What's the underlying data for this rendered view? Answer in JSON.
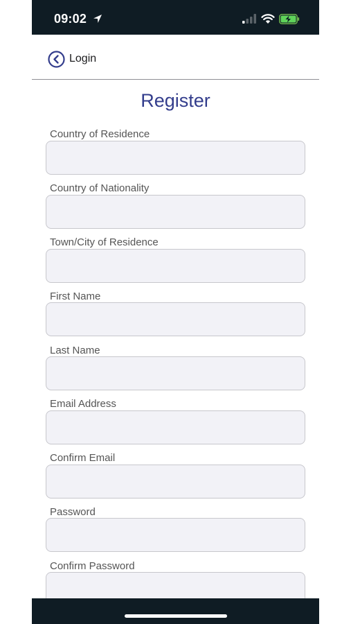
{
  "status_bar": {
    "time": "09:02",
    "icons": [
      "location-arrow-icon",
      "cellular-signal-icon",
      "wifi-icon",
      "battery-charging-icon"
    ]
  },
  "nav": {
    "back_label": "Login",
    "back_icon": "chevron-left-circle-icon",
    "accent_color": "#333d8c"
  },
  "page": {
    "title": "Register"
  },
  "form": {
    "fields": [
      {
        "label": "Country of Residence",
        "value": ""
      },
      {
        "label": "Country of Nationality",
        "value": ""
      },
      {
        "label": "Town/City of Residence",
        "value": ""
      },
      {
        "label": "First Name",
        "value": ""
      },
      {
        "label": "Last Name",
        "value": ""
      },
      {
        "label": "Email Address",
        "value": ""
      },
      {
        "label": "Confirm Email",
        "value": ""
      },
      {
        "label": "Password",
        "value": ""
      },
      {
        "label": "Confirm Password",
        "value": ""
      }
    ]
  }
}
